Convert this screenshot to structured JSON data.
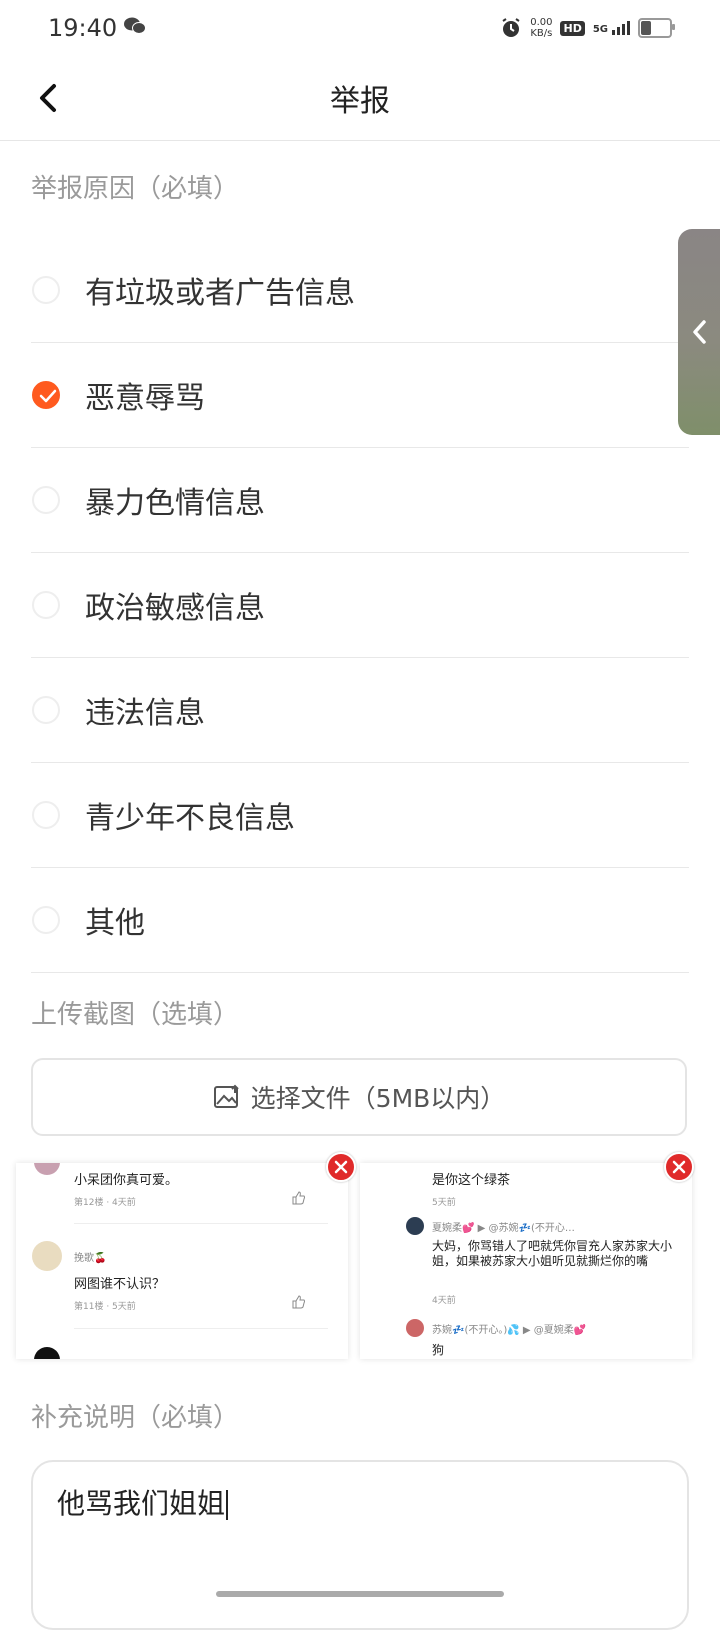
{
  "status": {
    "time": "19:40",
    "net_speed_value": "0.00",
    "net_speed_unit": "KB/s",
    "hd": "HD",
    "network": "5G",
    "icons": [
      "wechat-icon",
      "alarm-icon",
      "signal-icon",
      "battery-icon"
    ]
  },
  "header": {
    "title": "举报",
    "back_icon": "chevron-left-icon"
  },
  "reasons": {
    "label": "举报原因（必填）",
    "items": [
      {
        "label": "有垃圾或者广告信息",
        "selected": false
      },
      {
        "label": "恶意辱骂",
        "selected": true
      },
      {
        "label": "暴力色情信息",
        "selected": false
      },
      {
        "label": "政治敏感信息",
        "selected": false
      },
      {
        "label": "违法信息",
        "selected": false
      },
      {
        "label": "青少年不良信息",
        "selected": false
      },
      {
        "label": "其他",
        "selected": false
      }
    ]
  },
  "upload": {
    "label": "上传截图（选填）",
    "button_label": "选择文件（5MB以内）",
    "thumbnails": [
      {
        "c1_text": "小呆团你真可爱。",
        "c1_meta": "第12楼 · 4天前",
        "c2_name": "挽歌🍒",
        "c2_text": "网图谁不认识？",
        "c2_meta": "第11楼 · 5天前"
      },
      {
        "c1_text": "是你这个绿茶",
        "c1_meta": "5天前",
        "c2_head": "夏婉柔💕 ▶ @苏婉💤(不开心…",
        "c2_text": "大妈，你骂错人了吧就凭你冒充人家苏家大小姐，如果被苏家大小姐听见就撕烂你的嘴",
        "c2_meta": "4天前",
        "c3_head": "苏婉💤(不开心。)💦 ▶ @夏婉柔💕",
        "c3_text": "狗"
      }
    ]
  },
  "supplement": {
    "label": "补充说明（必填）",
    "value": "他骂我们姐姐"
  },
  "colors": {
    "accent": "#ff5a1f",
    "delete": "#e02a2a"
  }
}
